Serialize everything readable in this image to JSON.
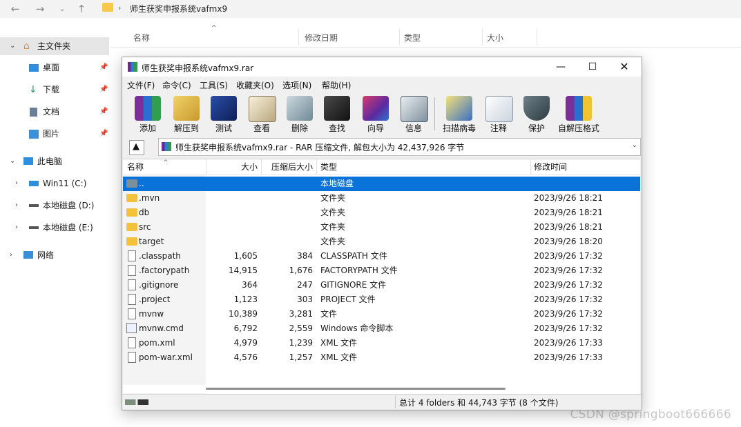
{
  "explorer": {
    "address": "师生获奖申报系统vafmx9",
    "sidebar": {
      "home": "主文件夹",
      "desktop": "桌面",
      "downloads": "下载",
      "documents": "文档",
      "pictures": "图片",
      "this_pc": "此电脑",
      "drive_c": "Win11 (C:)",
      "drive_d": "本地磁盘 (D:)",
      "drive_e": "本地磁盘 (E:)",
      "network": "网络"
    },
    "columns": {
      "name": "名称",
      "date": "修改日期",
      "type": "类型",
      "size": "大小"
    }
  },
  "rar": {
    "title": "师生获奖申报系统vafmx9.rar",
    "menu": [
      "文件(F)",
      "命令(C)",
      "工具(S)",
      "收藏夹(O)",
      "选项(N)",
      "帮助(H)"
    ],
    "toolbar": [
      "添加",
      "解压到",
      "测试",
      "查看",
      "删除",
      "查找",
      "向导",
      "信息",
      "扫描病毒",
      "注释",
      "保护",
      "自解压格式"
    ],
    "path": "师生获奖申报系统vafmx9.rar - RAR 压缩文件, 解包大小为 42,437,926 字节",
    "columns": {
      "name": "名称",
      "size": "大小",
      "packed": "压缩后大小",
      "type": "类型",
      "modified": "修改时间"
    },
    "rows": [
      {
        "name": "..",
        "size": "",
        "packed": "",
        "type": "本地磁盘",
        "modified": "",
        "icon": "up-folder-icon"
      },
      {
        "name": ".mvn",
        "size": "",
        "packed": "",
        "type": "文件夹",
        "modified": "2023/9/26 18:21",
        "icon": "folder-icon"
      },
      {
        "name": "db",
        "size": "",
        "packed": "",
        "type": "文件夹",
        "modified": "2023/9/26 18:21",
        "icon": "folder-icon"
      },
      {
        "name": "src",
        "size": "",
        "packed": "",
        "type": "文件夹",
        "modified": "2023/9/26 18:21",
        "icon": "folder-icon"
      },
      {
        "name": "target",
        "size": "",
        "packed": "",
        "type": "文件夹",
        "modified": "2023/9/26 18:20",
        "icon": "folder-icon"
      },
      {
        "name": ".classpath",
        "size": "1,605",
        "packed": "384",
        "type": "CLASSPATH 文件",
        "modified": "2023/9/26 17:32",
        "icon": "file-icon"
      },
      {
        "name": ".factorypath",
        "size": "14,915",
        "packed": "1,676",
        "type": "FACTORYPATH 文件",
        "modified": "2023/9/26 17:32",
        "icon": "file-icon"
      },
      {
        "name": ".gitignore",
        "size": "364",
        "packed": "247",
        "type": "GITIGNORE 文件",
        "modified": "2023/9/26 17:32",
        "icon": "file-icon"
      },
      {
        "name": ".project",
        "size": "1,123",
        "packed": "303",
        "type": "PROJECT 文件",
        "modified": "2023/9/26 17:32",
        "icon": "file-icon"
      },
      {
        "name": "mvnw",
        "size": "10,389",
        "packed": "3,281",
        "type": "文件",
        "modified": "2023/9/26 17:32",
        "icon": "file-icon"
      },
      {
        "name": "mvnw.cmd",
        "size": "6,792",
        "packed": "2,559",
        "type": "Windows 命令脚本",
        "modified": "2023/9/26 17:32",
        "icon": "script-icon"
      },
      {
        "name": "pom.xml",
        "size": "4,979",
        "packed": "1,239",
        "type": "XML 文件",
        "modified": "2023/9/26 17:33",
        "icon": "file-icon"
      },
      {
        "name": "pom-war.xml",
        "size": "4,576",
        "packed": "1,257",
        "type": "XML 文件",
        "modified": "2023/9/26 17:33",
        "icon": "file-icon"
      }
    ],
    "status": "总计 4 folders 和 44,743 字节 (8 个文件)"
  },
  "watermark": "CSDN @springboot666666",
  "colors": {
    "selection": "#0a73d9",
    "folder": "#f3c23c"
  }
}
